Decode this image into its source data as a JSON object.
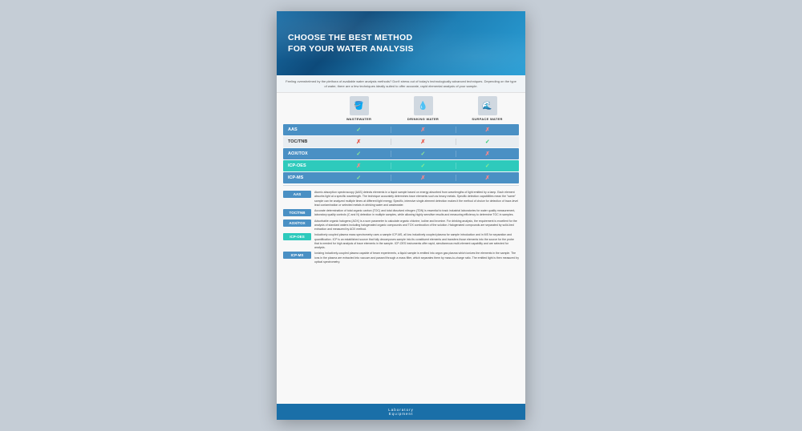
{
  "poster": {
    "title_line1": "CHOOSE THE BEST METHOD",
    "title_line2": "FOR YOUR WATER ANALYSIS",
    "subtitle": "Feeling overwhelmed by the plethora of available water analysis methods? Don't stress out of today's technologically advanced techniques. Depending on the type of water, there are a few techniques ideally suited to offer accurate, rapid elemental analysis of your sample.",
    "categories": [
      {
        "id": "wastewater",
        "label": "WASTEWATER",
        "icon": "🪣"
      },
      {
        "id": "drinking",
        "label": "DRINKING WATER",
        "icon": "💧"
      },
      {
        "id": "surface",
        "label": "SURFACE WATER",
        "icon": "🌊"
      }
    ],
    "table_rows": [
      {
        "method": "AAS",
        "cells": [
          "✓",
          "✗",
          "✗"
        ],
        "style": "blue"
      },
      {
        "method": "TOC/TNB",
        "cells": [
          "✗",
          "✗",
          "✓"
        ],
        "style": "light"
      },
      {
        "method": "AOX/TOX",
        "cells": [
          "✓",
          "✓",
          "✗"
        ],
        "style": "blue"
      },
      {
        "method": "ICP-OES",
        "cells": [
          "✗",
          "✓",
          "✓"
        ],
        "style": "teal"
      },
      {
        "method": "ICP-MS",
        "cells": [
          "✓",
          "✗",
          "✗"
        ],
        "style": "blue"
      }
    ],
    "descriptions": [
      {
        "label": "AAS",
        "style": "blue",
        "text": "Atomic absorption spectroscopy (AAS) detects elements in a liquid sample based on energy absorbed from wavelengths of light emitted by a lamp. Each element absorbs light at a specific wavelength. The technique accurately determines trace elements such as heavy metals. Specific detection capabilities mean the \"same\" sample can be analyzed multiple times at different light energy, Specific, intensive single-element detection makes it the method of choice for detection of trace-level lead contamination or selected metals in drinking water and wastewater."
      },
      {
        "label": "TOC/TNB",
        "style": "blue",
        "text": "Accurate determination of total organic carbon (TOC) and total dissolved nitrogen (TDN) is essential to track industrial laboratories for water quality measurement, laboratory quality controls (C and N) detection in multiple samples, while allowing highly sensitive results and measuring efficiency to determine TOC in samples."
      },
      {
        "label": "AOX/TOX",
        "style": "blue",
        "text": "Adsorbable organic halogens (AOX) is a sum parameter to calculate organic chlorine, iodine and bromine. For drinking analysis, the requirement is excellent for the analysis of standard waters including halogenated organic compounds and TOX combustion of the solution. Halogenated compounds are separated by solid-bed extraction and measured by AOX method."
      },
      {
        "label": "ICP-OES",
        "style": "teal",
        "text": "Inductively coupled plasma mass spectrometry uses a sample ICP-MS, all low inductively coupled plasma for sample introduction and in MS for separation and quantification. ICP is an established source that fully decomposes sample into its constituent elements and transfers those elements into the source for the probe that is needed for high analysis of trace elements in the sample. ICP-OES instruments offer rapid, simultaneous multi-element capability and are selected for analysis."
      },
      {
        "label": "ICP-MS",
        "style": "blue",
        "text": "Ionizing inductively-coupled plasma capable of beam experiments, a liquid sample is emitted into argon gas plasma which ionizes the elements in the sample. The ions in the plasma are extracted into vacuum and passed through a mass filter, which separates them by mass-to-charge ratio. The emitted light is then measured by optical spectrometry."
      }
    ],
    "footer": {
      "logo_main": "Laboratory",
      "logo_sub": "Equipment"
    }
  }
}
